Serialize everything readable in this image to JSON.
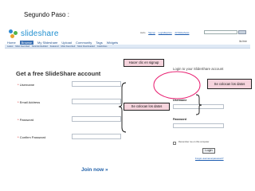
{
  "caption": "Segundo Paso :",
  "header": {
    "logo_text": "slideshare",
    "top_links": [
      "Hello",
      "Signup",
      "Login/Explore",
      "All Slideshows"
    ],
    "nav": [
      "Home",
      "Browse",
      "My Slideshare",
      "Upload",
      "Community",
      "Tags",
      "Widgets"
    ],
    "nav_right": "Its free",
    "subnav": [
      "Latest",
      "Most Favorited",
      "Most Embedded",
      "Featured",
      "Most Favorited",
      "Most Downloaded",
      "Celebrities"
    ]
  },
  "signup": {
    "title": "Get a free SlideShare account",
    "fields": [
      {
        "label": "Username",
        "required": "*"
      },
      {
        "label": "Email Address",
        "required": "*"
      },
      {
        "label": "Password",
        "required": "*"
      },
      {
        "label": "Confirm Password",
        "required": "*"
      }
    ],
    "join_label": "Join now »"
  },
  "login": {
    "title": "Login to your SlideShare account",
    "username_label": "Username",
    "password_label": "Password",
    "remember_label": "Remember me on this computer",
    "login_button": "Login",
    "forgot_link": "Forgot username/password?"
  },
  "annotations": {
    "signup_note": "Hacer clic en signup",
    "data_note_left": "Se colocan los datos",
    "data_note_right": "Se colocan los datos",
    "accent_color": "#e8196d",
    "callout_fill": "#f6d4dd"
  }
}
